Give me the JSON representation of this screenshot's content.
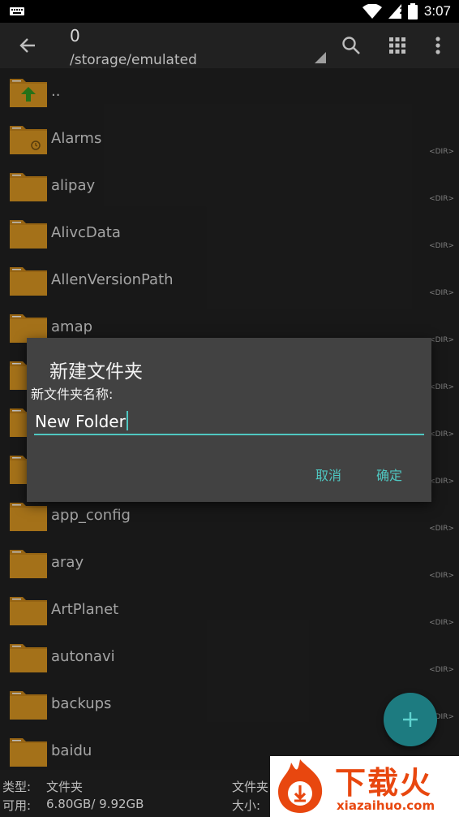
{
  "status_bar": {
    "time": "3:07",
    "battery_level": "2"
  },
  "toolbar": {
    "title": "0",
    "path": "/storage/emulated"
  },
  "files": [
    {
      "name": "..",
      "type": ""
    },
    {
      "name": "Alarms",
      "type": "<DIR>"
    },
    {
      "name": "alipay",
      "type": "<DIR>"
    },
    {
      "name": "AlivcData",
      "type": "<DIR>"
    },
    {
      "name": "AllenVersionPath",
      "type": "<DIR>"
    },
    {
      "name": "amap",
      "type": "<DIR>"
    },
    {
      "name": "",
      "type": "<DIR>"
    },
    {
      "name": "",
      "type": "<DIR>"
    },
    {
      "name": "",
      "type": "<DIR>"
    },
    {
      "name": "app_config",
      "type": "<DIR>"
    },
    {
      "name": "aray",
      "type": "<DIR>"
    },
    {
      "name": "ArtPlanet",
      "type": "<DIR>"
    },
    {
      "name": "autonavi",
      "type": "<DIR>"
    },
    {
      "name": "backups",
      "type": "<DIR>"
    },
    {
      "name": "baidu",
      "type": ""
    }
  ],
  "dialog": {
    "title": "新建文件夹",
    "label": "新文件夹名称:",
    "input_value": "New Folder",
    "cancel": "取消",
    "confirm": "确定"
  },
  "bottom_info": {
    "type_label": "类型:",
    "type_value": "文件夹",
    "available_label": "可用:",
    "available_value": "6.80GB/ 9.92GB",
    "right_top": "文件夹",
    "right_bottom": "大小:"
  },
  "watermark": {
    "text": "下载火",
    "url": "xiazaihuo.com"
  },
  "colors": {
    "accent": "#4fc7c1",
    "folder": "#c98a1f",
    "fab": "#1d7b80"
  }
}
